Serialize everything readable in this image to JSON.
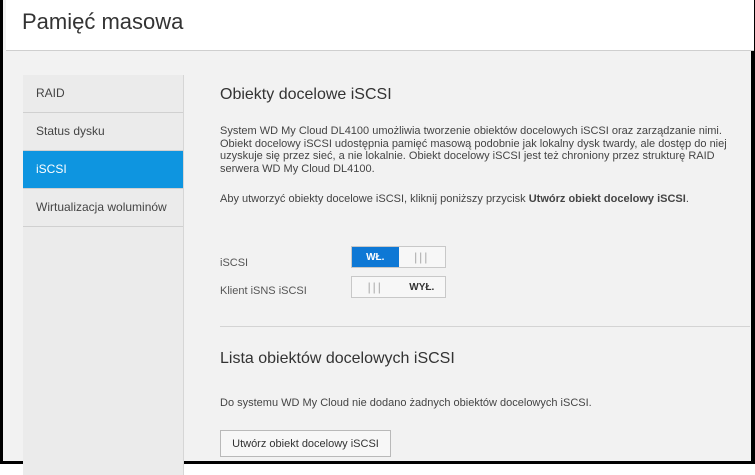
{
  "header": {
    "title": "Pamięć masowa"
  },
  "sidebar": {
    "items": [
      {
        "label": "RAID"
      },
      {
        "label": "Status dysku"
      },
      {
        "label": "iSCSI"
      },
      {
        "label": "Wirtualizacja woluminów"
      }
    ],
    "active_index": 2
  },
  "targets": {
    "title": "Obiekty docelowe iSCSI",
    "description": "System WD My Cloud DL4100 umożliwia tworzenie obiektów docelowych iSCSI oraz zarządzanie nimi. Obiekt docelowy iSCSI udostępnia pamięć masową podobnie jak lokalny dysk twardy, ale dostęp do niej uzyskuje się przez sieć, a nie lokalnie. Obiekt docelowy iSCSI jest też chroniony przez strukturę RAID serwera WD My Cloud DL4100.",
    "instruction_prefix": "Aby utworzyć obiekty docelowe iSCSI, kliknij poniższy przycisk ",
    "instruction_bold": "Utwórz obiekt docelowy iSCSI",
    "instruction_suffix": "."
  },
  "settings": {
    "iscsi": {
      "label": "iSCSI",
      "on_label": "WŁ.",
      "state": "on"
    },
    "isns": {
      "label": "Klient iSNS iSCSI",
      "off_label": "WYŁ.",
      "state": "off"
    }
  },
  "list": {
    "title": "Lista obiektów docelowych iSCSI",
    "empty_text": "Do systemu WD My Cloud nie dodano żadnych obiektów docelowych iSCSI.",
    "create_button": "Utwórz obiekt docelowy iSCSI"
  },
  "colors": {
    "accent": "#0e95e0",
    "toggle_on": "#0e78d5"
  }
}
